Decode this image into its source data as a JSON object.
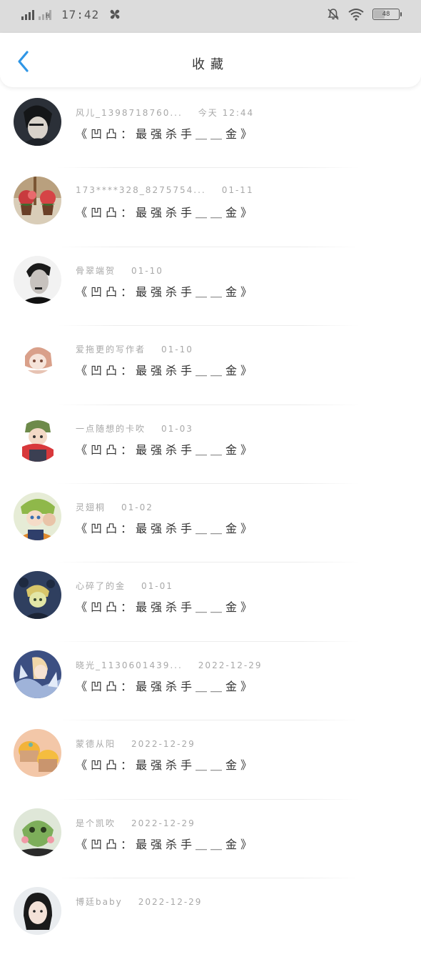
{
  "status_bar": {
    "network": "H",
    "time": "17:42",
    "battery": "48",
    "battery_level": 0.48
  },
  "nav": {
    "title": "收藏"
  },
  "items": [
    {
      "user": "风儿_1398718760...",
      "date": "今天 12:44",
      "title": "《凹凸：最强杀手＿＿金》"
    },
    {
      "user": "173****328_8275754...",
      "date": "01-11",
      "title": "《凹凸：最强杀手＿＿金》"
    },
    {
      "user": "骨翠端贺",
      "date": "01-10",
      "title": "《凹凸：最强杀手＿＿金》"
    },
    {
      "user": "爱拖更的写作者",
      "date": "01-10",
      "title": "《凹凸：最强杀手＿＿金》"
    },
    {
      "user": "一点随想的卡吹",
      "date": "01-03",
      "title": "《凹凸：最强杀手＿＿金》"
    },
    {
      "user": "灵翅桐",
      "date": "01-02",
      "title": "《凹凸：最强杀手＿＿金》"
    },
    {
      "user": "心碎了的金",
      "date": "01-01",
      "title": "《凹凸：最强杀手＿＿金》"
    },
    {
      "user": "晓光_1130601439...",
      "date": "2022-12-29",
      "title": "《凹凸：最强杀手＿＿金》"
    },
    {
      "user": "蒙德从阳",
      "date": "2022-12-29",
      "title": "《凹凸：最强杀手＿＿金》"
    },
    {
      "user": "是个凯吹",
      "date": "2022-12-29",
      "title": "《凹凸：最强杀手＿＿金》"
    },
    {
      "user": "博廷baby",
      "date": "2022-12-29",
      "title": ""
    }
  ],
  "colors": {
    "accent": "#2f96e6",
    "status_bar_bg": "#dcdcdc",
    "meta_text": "#a8a8a8",
    "title_text": "#333333"
  },
  "icons": {
    "back": "back-arrow-icon",
    "signal": "signal-icon",
    "fan": "fan-icon",
    "mute": "bell-off-icon",
    "wifi": "wifi-icon",
    "battery": "battery-icon"
  }
}
